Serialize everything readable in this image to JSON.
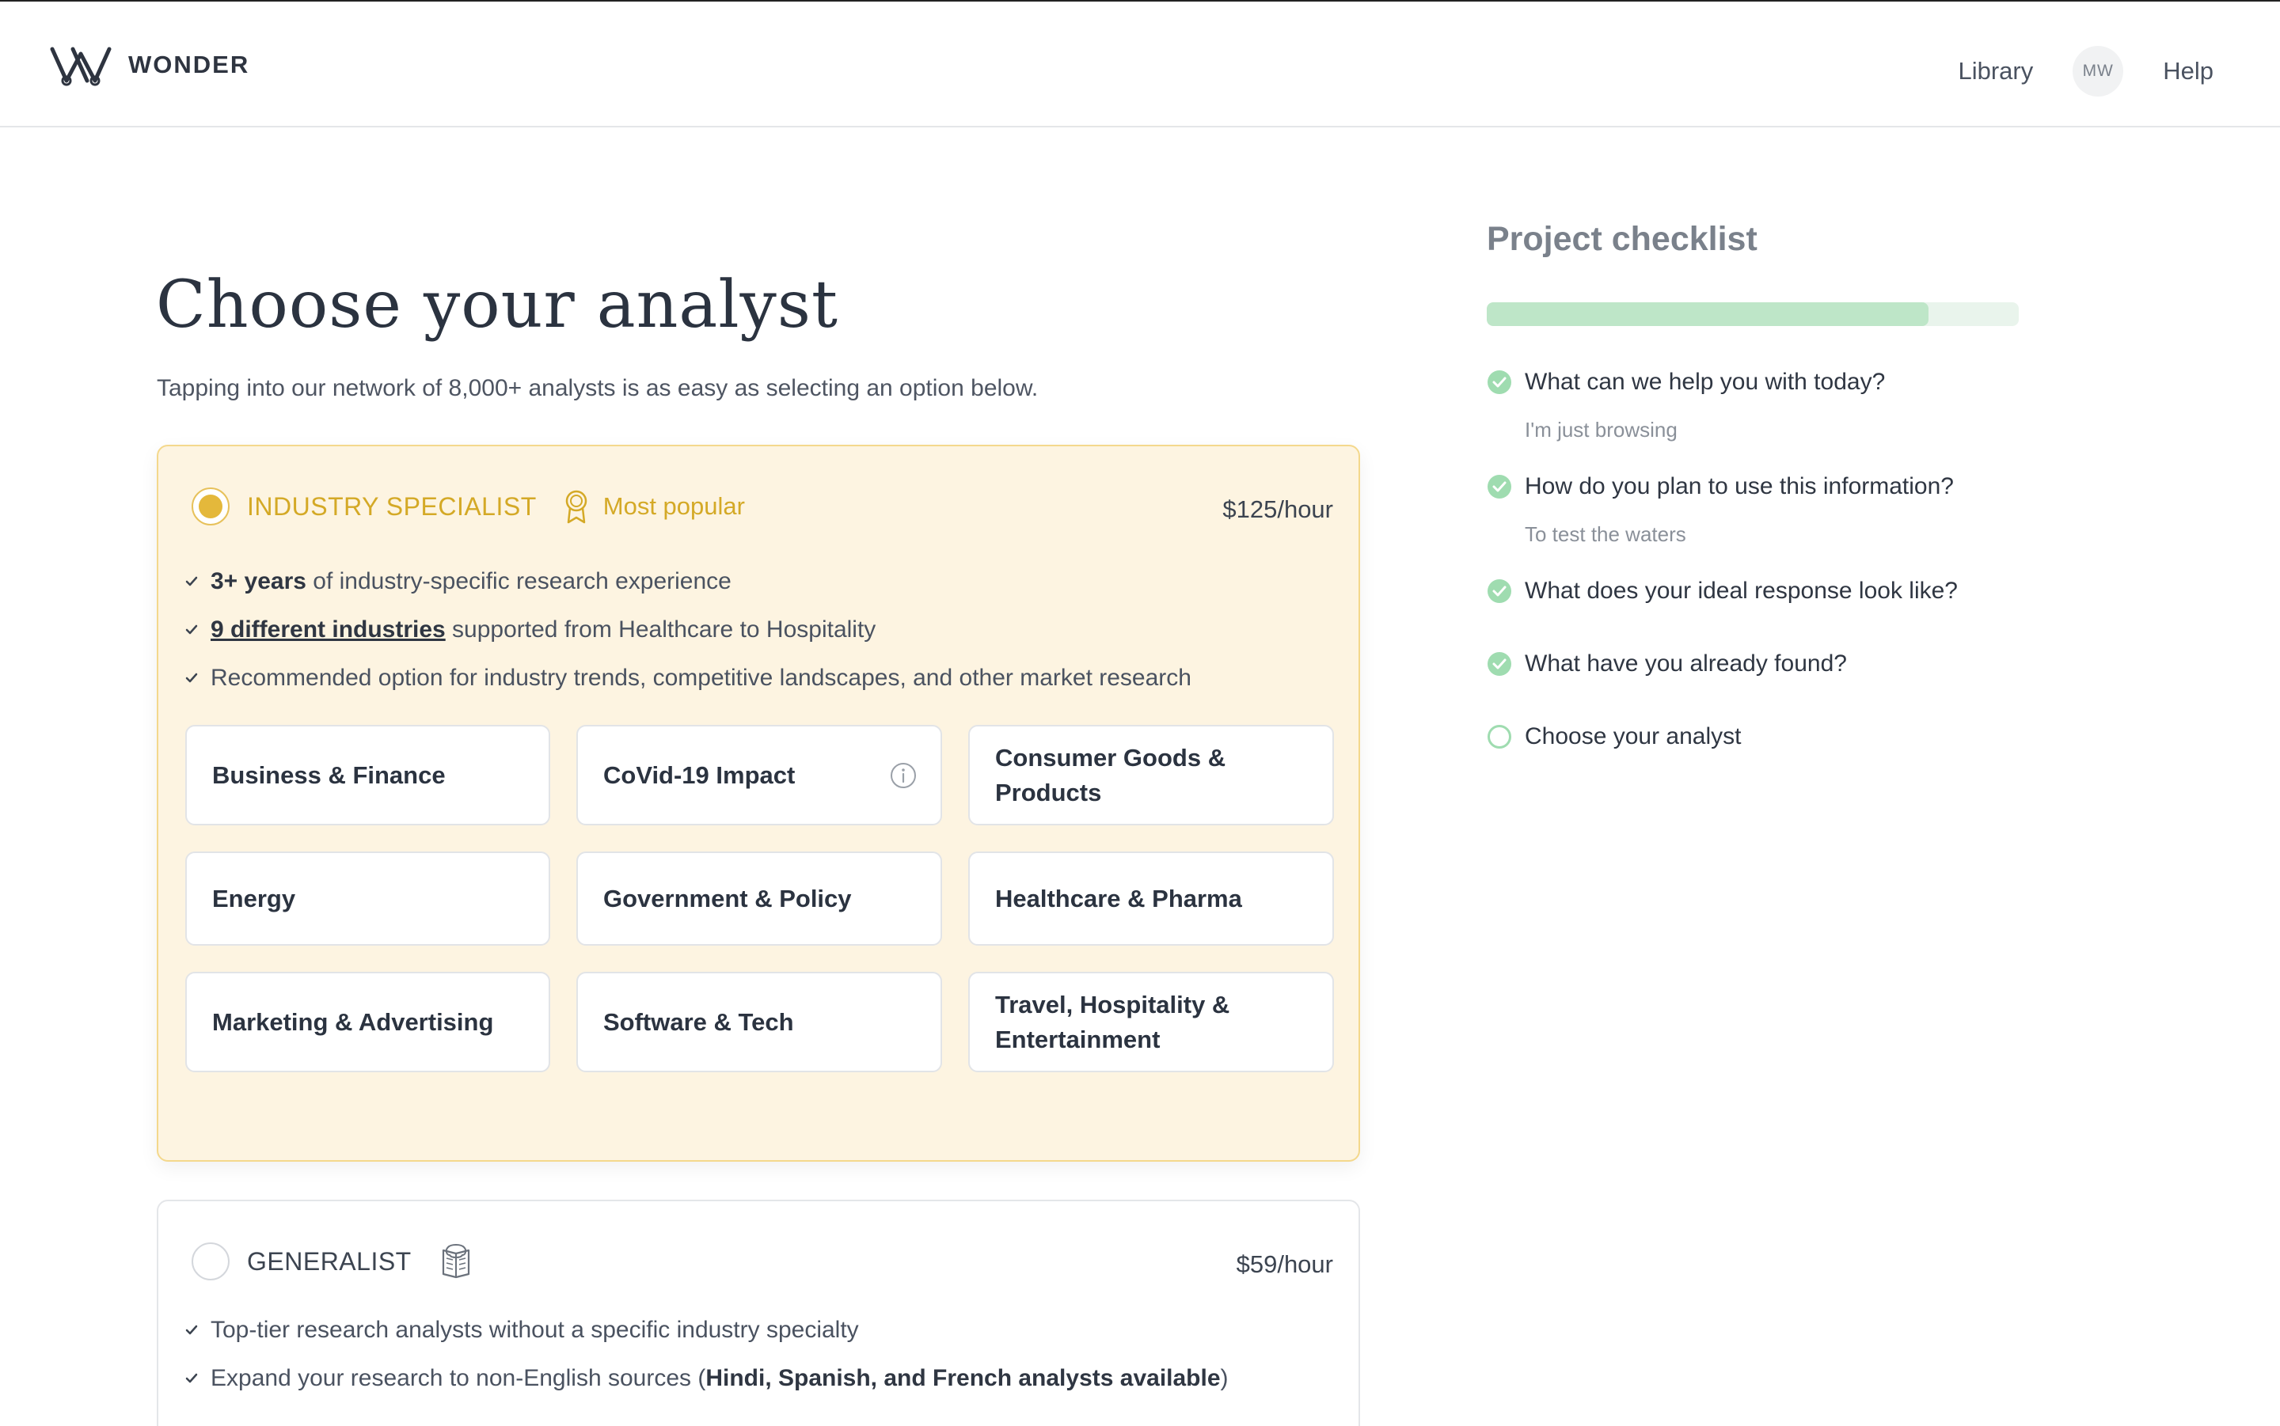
{
  "header": {
    "brand": "WONDER",
    "nav_library": "Library",
    "avatar_initials": "MW",
    "nav_help": "Help"
  },
  "main": {
    "title": "Choose your analyst",
    "subtitle": "Tapping into our network of 8,000+ analysts is as easy as selecting an option below."
  },
  "specialist": {
    "name": "INDUSTRY SPECIALIST",
    "badge": "Most popular",
    "price": "$125/hour",
    "selected": true,
    "f1_bold": "3+ years",
    "f1_rest": " of industry-specific research experience",
    "f2_link": "9 different industries",
    "f2_rest": " supported from Healthcare to Hospitality",
    "f3": "Recommended option for industry trends, competitive landscapes, and other market research",
    "industries": [
      "Business & Finance",
      "CoVid-19 Impact",
      "Consumer Goods & Products",
      "Energy",
      "Government & Policy",
      "Healthcare & Pharma",
      "Marketing & Advertising",
      "Software & Tech",
      "Travel, Hospitality & Entertainment"
    ]
  },
  "generalist": {
    "name": "GENERALIST",
    "price": "$59/hour",
    "selected": false,
    "f1": "Top-tier research analysts without a specific industry specialty",
    "f2_pre": "Expand your research to non-English sources (",
    "f2_bold": "Hindi, Spanish, and French analysts available",
    "f2_post": ")"
  },
  "checklist": {
    "title": "Project checklist",
    "progress_fraction": 0.83,
    "items": [
      {
        "label": "What can we help you with today?",
        "answer": "I'm just browsing",
        "done": true
      },
      {
        "label": "How do you plan to use this information?",
        "answer": "To test the waters",
        "done": true
      },
      {
        "label": "What does your ideal response look like?",
        "done": true
      },
      {
        "label": "What have you already found?",
        "done": true
      },
      {
        "label": "Choose your analyst",
        "done": false
      }
    ]
  },
  "colors": {
    "accent_gold": "#d4a926",
    "card_bg": "#fdf4e1",
    "check_green": "#9fdcb0",
    "progress_fill": "#bee6c8"
  }
}
